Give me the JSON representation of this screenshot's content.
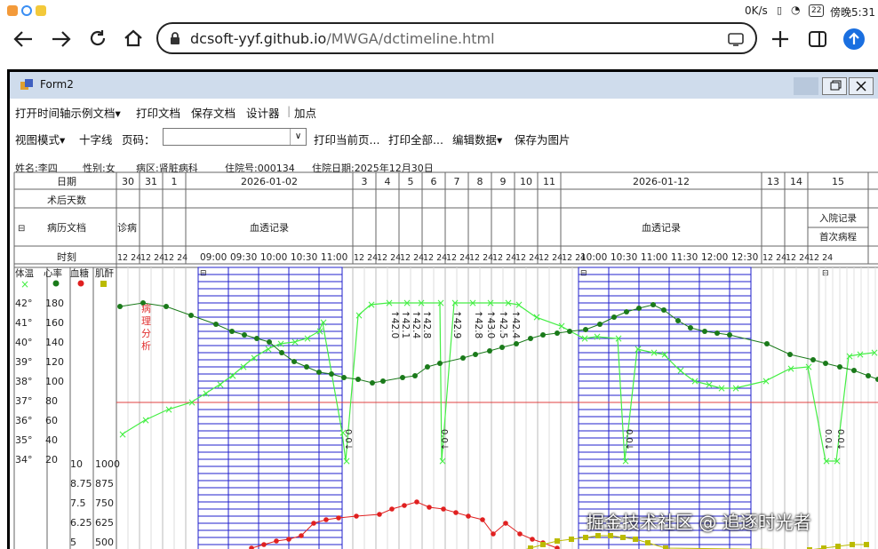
{
  "status": {
    "net_speed": "0K/s",
    "battery": "22",
    "time": "傍晚5:31"
  },
  "browser": {
    "url_host": "dcsoft-yyf.github.io",
    "url_path": "/MWGA/dctimeline.html"
  },
  "window": {
    "title": "Form2"
  },
  "menu": {
    "open_example": "打开时间轴示例文档▾",
    "print_doc": "打印文档",
    "save_doc": "保存文档",
    "designer": "设计器",
    "add_point": "加点",
    "view_mode": "视图模式▾",
    "crosshair": "十字线",
    "page_label": "页码：",
    "print_current": "打印当前页...",
    "print_all": "打印全部...",
    "edit_data": "编辑数据▾",
    "save_image": "保存为图片"
  },
  "patient": {
    "name": "姓名:李四",
    "gender": "性别:女",
    "ward": "病区:肾脏病科",
    "admission_no": "住院号:000134",
    "admission_date": "住院日期:2025年12月30日"
  },
  "table": {
    "row_date": "日期",
    "row_postop": "术后天数",
    "row_records": "病历文档",
    "row_time": "时刻",
    "dates": [
      "30",
      "31",
      "1",
      "2026-01-02",
      "3",
      "4",
      "5",
      "6",
      "7",
      "8",
      "9",
      "10",
      "11",
      "2026-01-12",
      "13",
      "14",
      "15"
    ],
    "records_col1": "诊病",
    "records_dialysis": "血透记录",
    "records_admit": "入院记录",
    "records_first": "首次病程",
    "hours_short": "12 24",
    "dialysis_times_1": [
      "09:00",
      "09:30",
      "10:00",
      "10:30",
      "11:00"
    ],
    "dialysis_times_2": [
      "10:00",
      "10:30",
      "11:00",
      "11:30",
      "12:00",
      "12:30"
    ],
    "series_labels": {
      "temp": "体温",
      "pulse": "心率",
      "glucose": "血糖",
      "creat": "肌酐"
    },
    "temp_ticks": [
      "42°",
      "41°",
      "40°",
      "39°",
      "38°",
      "37°",
      "36°",
      "35°",
      "34°"
    ],
    "pulse_ticks": [
      "180",
      "160",
      "140",
      "120",
      "100",
      "80",
      "60",
      "40",
      "20"
    ],
    "glucose_ticks": [
      "10",
      "8.75",
      "7.5",
      "6.25",
      "5"
    ],
    "creat_ticks": [
      "1000",
      "875",
      "750",
      "625",
      "500"
    ],
    "annotation_vertical": "病理分析",
    "arrow_labels": [
      "42.0",
      "42.1",
      "42.4",
      "42.8",
      "42.9",
      "42.8",
      "43.0",
      "42.5",
      "42.4"
    ],
    "zero_label": "0.0",
    "line_37_color": "#e04040"
  },
  "watermark": "掘金技术社区 @ 追逐时光者",
  "colors": {
    "temp": "#44ee44",
    "pulse": "#1a7a1a",
    "glucose": "#e02020",
    "creat": "#bbbb00",
    "dialysis_band": "#2222cc"
  }
}
